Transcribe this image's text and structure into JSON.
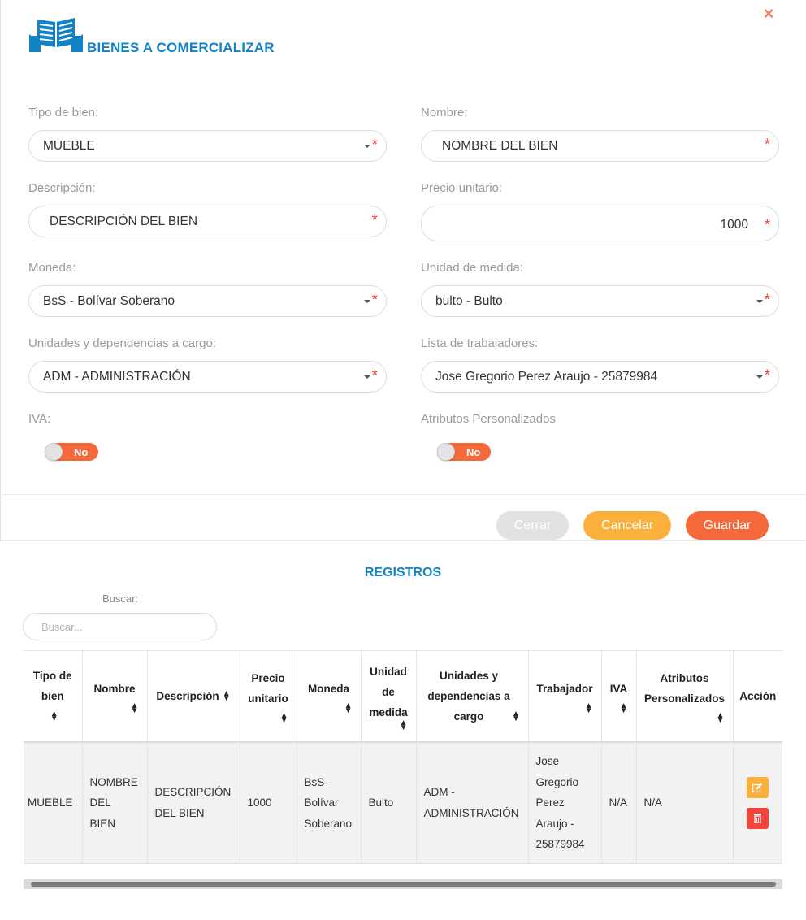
{
  "form": {
    "title": "BIENES A COMERCIALIZAR",
    "close_icon": "×",
    "fields": {
      "tipo_bien": {
        "label": "Tipo de bien:",
        "value": "MUEBLE"
      },
      "nombre": {
        "label": "Nombre:",
        "value": "NOMBRE DEL BIEN"
      },
      "descripcion": {
        "label": "Descripción:",
        "value": "DESCRIPCIÓN DEL BIEN"
      },
      "precio": {
        "label": "Precio unitario:",
        "value": "1000"
      },
      "moneda": {
        "label": "Moneda:",
        "value": "BsS - Bolívar Soberano"
      },
      "unidad": {
        "label": "Unidad de medida:",
        "value": "bulto - Bulto"
      },
      "dependencias": {
        "label": "Unidades y dependencias a cargo:",
        "value": "ADM - ADMINISTRACIÓN"
      },
      "trabajadores": {
        "label": "Lista de trabajadores:",
        "value": "Jose Gregorio Perez Araujo - 25879984"
      }
    },
    "required_mark": "*",
    "iva": {
      "label": "IVA:",
      "toggle": "No"
    },
    "atributos": {
      "label": "Atributos Personalizados",
      "toggle": "No"
    },
    "buttons": {
      "cerrar": "Cerrar",
      "cancelar": "Cancelar",
      "guardar": "Guardar"
    }
  },
  "registros": {
    "title": "REGISTROS",
    "search_label": "Buscar:",
    "search_placeholder": "Buscar...",
    "columns": [
      "Tipo de bien",
      "Nombre",
      "Descripción",
      "Precio unitario",
      "Moneda",
      "Unidad de medida",
      "Unidades y dependencias a cargo",
      "Trabajador",
      "IVA",
      "Atributos Personalizados",
      "Acción"
    ],
    "rows": [
      [
        "MUEBLE",
        "NOMBRE DEL BIEN",
        "DESCRIPCIÓN DEL BIEN",
        "1000",
        "BsS - Bolívar Soberano",
        "Bulto",
        "ADM - ADMINISTRACIÓN",
        "Jose Gregorio Perez Araujo - 25879984",
        "N/A",
        "N/A"
      ]
    ]
  },
  "colors": {
    "accent_blue": "#1483c6",
    "orange": "#f5683a",
    "yellow": "#fbb03b",
    "red": "#f0463c"
  }
}
